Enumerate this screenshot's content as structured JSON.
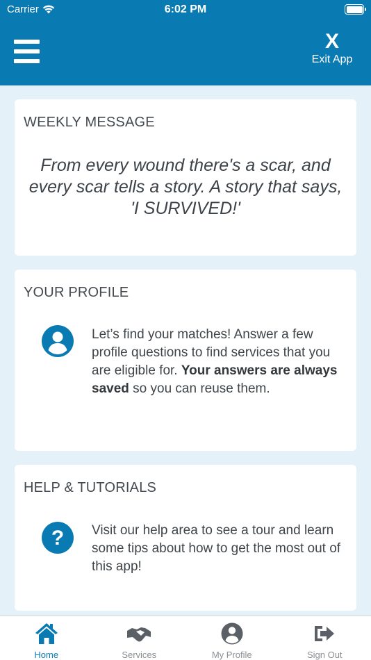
{
  "status_bar": {
    "carrier": "Carrier",
    "time": "6:02 PM"
  },
  "header": {
    "exit_icon_glyph": "X",
    "exit_label": "Exit App",
    "menu_icon": "hamburger-menu-icon",
    "background": "#0a7bb2"
  },
  "weekly_message": {
    "title": "WEEKLY MESSAGE",
    "quote": "From every wound there's a scar, and every scar tells a story. A story that says, 'I SURVIVED!'"
  },
  "profile_card": {
    "title": "YOUR PROFILE",
    "icon": "user-circle-icon",
    "text_before": "Let’s find your matches! Answer a few profile questions to find services that you are eligible for. ",
    "text_bold": "Your answers are always saved",
    "text_after": " so you can reuse them."
  },
  "help_card": {
    "title": "HELP & TUTORIALS",
    "icon": "question-circle-icon",
    "text": "Visit our help area to see a tour and learn some tips about how to get the most out of this app!"
  },
  "tabbar": {
    "active": "Home",
    "tabs": [
      {
        "label": "Home",
        "icon": "home-icon"
      },
      {
        "label": "Services",
        "icon": "handshake-icon"
      },
      {
        "label": "My Profile",
        "icon": "user-circle-icon"
      },
      {
        "label": "Sign Out",
        "icon": "sign-out-icon"
      }
    ]
  },
  "colors": {
    "accent": "#0a7bb2",
    "page_bg": "#e5f1f8",
    "inactive_icon": "#5a6066"
  }
}
